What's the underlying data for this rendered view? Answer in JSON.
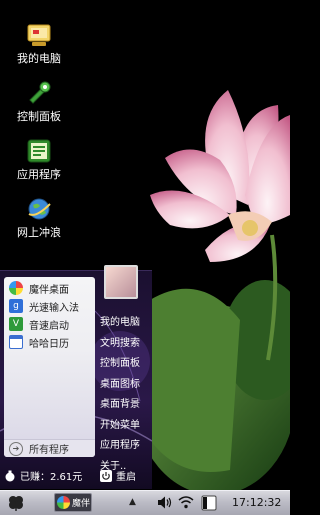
{
  "desktop": {
    "icons": [
      {
        "label": "我的电脑",
        "icon": "computer-icon"
      },
      {
        "label": "控制面板",
        "icon": "control-panel-icon"
      },
      {
        "label": "应用程序",
        "icon": "applications-icon"
      },
      {
        "label": "网上冲浪",
        "icon": "internet-icon"
      }
    ]
  },
  "startmenu": {
    "programs": [
      {
        "label": "魔伴桌面",
        "icon": "mobanzhuomian-icon"
      },
      {
        "label": "光速输入法",
        "icon": "input-method-icon"
      },
      {
        "label": "音速启动",
        "icon": "quick-launch-icon"
      },
      {
        "label": "哈哈日历",
        "icon": "calendar-icon"
      }
    ],
    "all_programs": "所有程序",
    "right_items": [
      "我的电脑",
      "文明搜索",
      "控制面板",
      "桌面图标",
      "桌面背景",
      "开始菜单",
      "应用程序",
      "关于.."
    ],
    "earned": "已赚：2.61元",
    "restart": "重启"
  },
  "taskbar": {
    "app_label": "魔伴",
    "clock": "17:12:32",
    "tray_icons": [
      "volume-icon",
      "wifi-icon",
      "battery-icon"
    ]
  },
  "colors": {
    "taskbar": "#bcbcc6",
    "menu_bg": "#2a1848",
    "panel_bg": "#eeeef2"
  }
}
